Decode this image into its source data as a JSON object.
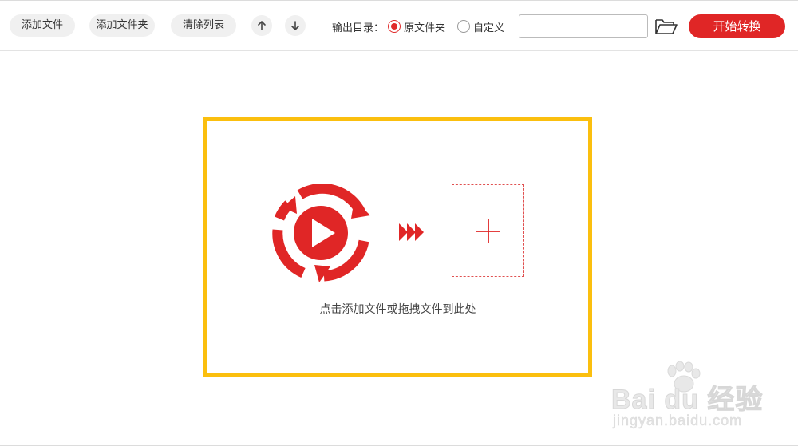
{
  "toolbar": {
    "add_file": "添加文件",
    "add_folder": "添加文件夹",
    "clear_list": "清除列表",
    "move_up_icon": "arrow-up-icon",
    "move_down_icon": "arrow-down-icon",
    "output_label": "输出目录：",
    "option_original": "原文件夹",
    "option_custom": "自定义",
    "selected_option": "原文件夹",
    "path_value": "",
    "path_placeholder": "",
    "folder_icon": "folder-open-icon",
    "start_button": "开始转换"
  },
  "drop_zone": {
    "hint": "点击添加文件或拖拽文件到此处",
    "video_icon": "video-convert-icon",
    "arrows_icon": "triple-arrow-icon",
    "add_icon": "plus-icon"
  },
  "watermark": {
    "brand": "Bai du 经验",
    "sub": "jingyan.baidu.com"
  },
  "colors": {
    "accent": "#e02626",
    "highlight_border": "#fbbf0e",
    "button_bg": "#f0f0f0"
  }
}
